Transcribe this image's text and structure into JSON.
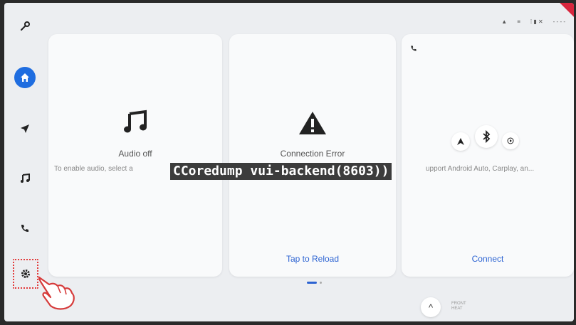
{
  "rail": {
    "items": [
      {
        "icon": "wrench-icon",
        "glyph": "✎"
      },
      {
        "icon": "home-icon",
        "glyph": "⌂"
      },
      {
        "icon": "navigation-icon",
        "glyph": "➤"
      },
      {
        "icon": "music-icon",
        "glyph": "♫"
      },
      {
        "icon": "phone-icon",
        "glyph": "✆"
      },
      {
        "icon": "gear-icon",
        "glyph": "⚙"
      }
    ]
  },
  "status": {
    "text1": "▲",
    "text2": "≡",
    "text3": "⁞ ▮ ✕",
    "time": "- - - -"
  },
  "cards": {
    "audio": {
      "title": "Audio off",
      "subtitle": "To enable audio, select a"
    },
    "connection": {
      "title": "Connection Error",
      "action": "Tap to Reload"
    },
    "phone": {
      "subtitle": "upport Android Auto, Carplay, an...",
      "action": "Connect"
    }
  },
  "error_banner": "CCoredump vui-backend(8603))",
  "bottom": {
    "chevron": "^",
    "front_line1": "FRONT",
    "front_line2": "HEAT"
  },
  "colors": {
    "accent": "#1f6de0",
    "link": "#2c63d2",
    "selection": "#e23b3b"
  }
}
